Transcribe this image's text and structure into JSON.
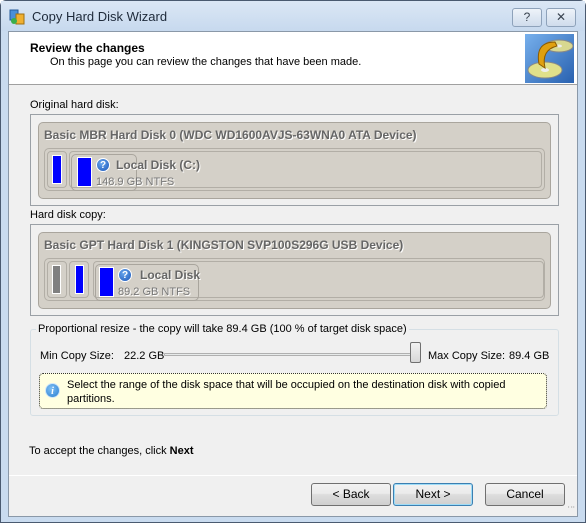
{
  "window": {
    "title": "Copy Hard Disk Wizard",
    "help_button": "?",
    "close_button": "✕"
  },
  "header": {
    "title": "Review the changes",
    "subtitle": "On this page you can review the changes that have been made."
  },
  "original": {
    "label": "Original hard disk:",
    "disk_title": "Basic MBR Hard Disk 0 (WDC WD1600AVJS-63WNA0 ATA Device)",
    "partition": {
      "name": "Local Disk (C:)",
      "size": "148.9 GB NTFS"
    }
  },
  "copy": {
    "label": "Hard disk copy:",
    "disk_title": "Basic GPT Hard Disk 1 (KINGSTON  SVP100S296G USB Device)",
    "partition": {
      "name": "Local Disk",
      "size": "89.2 GB NTFS"
    }
  },
  "resize": {
    "legend": "Proportional resize - the copy will take 89.4 GB (100 % of target disk space)",
    "min_label": "Min Copy Size:",
    "min_value": "22.2 GB",
    "max_label": "Max Copy Size:",
    "max_value": "89.4 GB",
    "slider_percent": 100,
    "info_text": "Select the range of the disk space that will be occupied on the destination disk with copied partitions."
  },
  "footer": {
    "accept_prefix": "To accept the changes, click ",
    "accept_bold": "Next"
  },
  "buttons": {
    "back": "< Back",
    "next": "Next >",
    "cancel": "Cancel"
  },
  "colors": {
    "partition_used": "#0000ff",
    "partition_unknown": "#808080",
    "disk_bg": "#d4d0c8"
  }
}
